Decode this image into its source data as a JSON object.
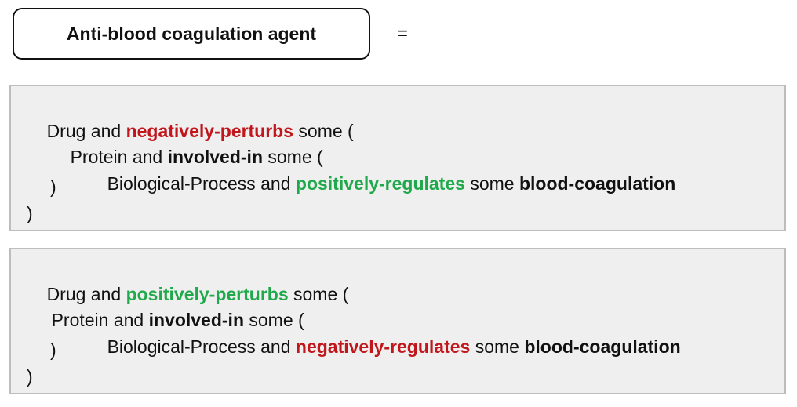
{
  "title": "Anti-blood coagulation agent",
  "equals": "=",
  "definition_1": {
    "line1": {
      "t1": "Drug and ",
      "rel": "negatively-perturbs",
      "t2": " some ("
    },
    "line2": {
      "t1": "Protein and ",
      "rel": "involved-in",
      "t2": " some ("
    },
    "line3": {
      "t1": "Biological-Process and ",
      "rel": "positively-regulates",
      "t2": " some ",
      "target": "blood-coagulation"
    },
    "line4": ")",
    "line5": ")",
    "colors": {
      "line1_rel": "#c0161c",
      "line3_rel": "#1fa94b"
    }
  },
  "definition_2": {
    "line1": {
      "t1": "Drug and ",
      "rel": "positively-perturbs",
      "t2": " some ("
    },
    "line2": {
      "t1": "Protein and ",
      "rel": "involved-in",
      "t2": " some ("
    },
    "line3": {
      "t1": "Biological-Process and ",
      "rel": "negatively-regulates",
      "t2": " some ",
      "target": "blood-coagulation"
    },
    "line4": ")",
    "line5": ")",
    "colors": {
      "line1_rel": "#1fa94b",
      "line3_rel": "#c0161c"
    }
  }
}
